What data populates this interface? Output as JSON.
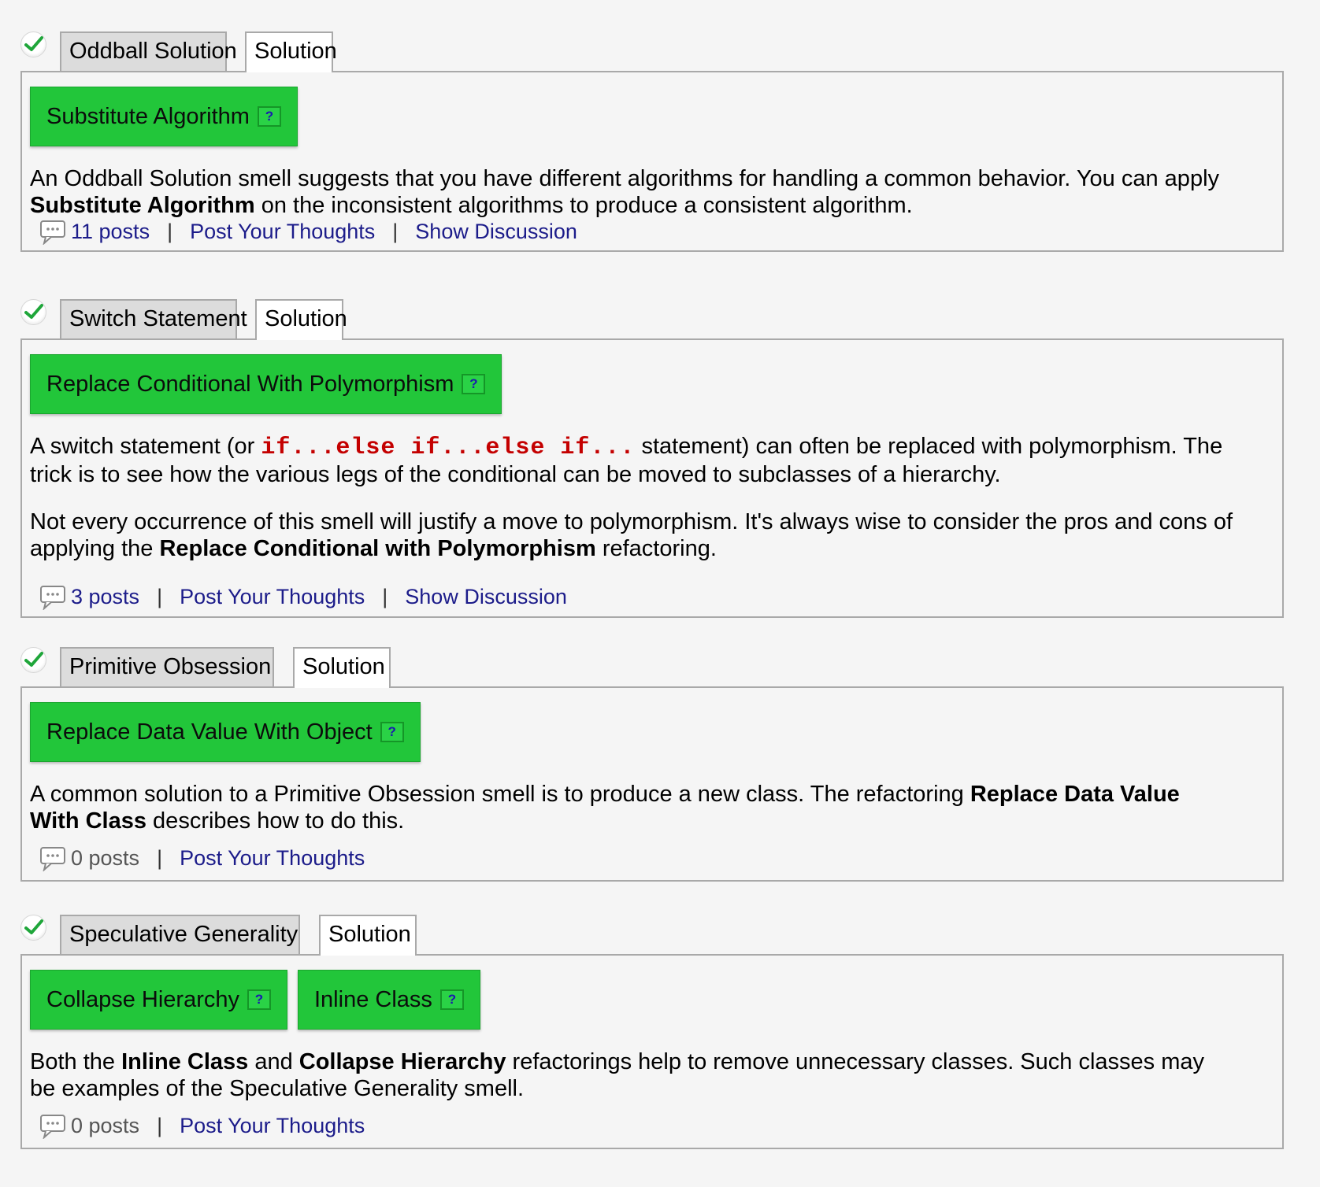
{
  "entries": [
    {
      "smell_tab": "Oddball Solution",
      "solution_tab": "Solution",
      "refactorings": [
        {
          "label": "Substitute Algorithm",
          "help": "?"
        }
      ],
      "desc_1": "An Oddball Solution smell suggests that you have different algorithms for handling a common behavior. You can apply ",
      "desc_bold": "Substitute Algorithm",
      "desc_2": " on the inconsistent algorithms to produce a consistent algorithm.",
      "posts": "11 posts",
      "post_thoughts": "Post Your Thoughts",
      "show_discussion": "Show Discussion",
      "separator": "|"
    },
    {
      "smell_tab": "Switch Statement",
      "solution_tab": "Solution",
      "refactorings": [
        {
          "label": "Replace Conditional With Polymorphism",
          "help": "?"
        }
      ],
      "desc_1": "A switch statement (or ",
      "desc_code": "if...else if...else if...",
      "desc_2": " statement) can often be replaced with polymorphism. The trick is to see how the various legs of the conditional can be moved to subclasses of a hierarchy.",
      "desc_3": "Not every occurrence of this smell will justify a move to polymorphism. It's always wise to consider the pros and cons of applying the ",
      "desc_bold": "Replace Conditional with Polymorphism",
      "desc_4": " refactoring.",
      "posts": "3 posts",
      "post_thoughts": "Post Your Thoughts",
      "show_discussion": "Show Discussion",
      "separator": "|"
    },
    {
      "smell_tab": "Primitive Obsession",
      "solution_tab": "Solution",
      "refactorings": [
        {
          "label": "Replace Data Value With Object",
          "help": "?"
        }
      ],
      "desc_1": "A common solution to a Primitive Obsession smell is to produce a new class. The refactoring ",
      "desc_bold": "Replace Data Value With Class",
      "desc_2": " describes how to do this.",
      "posts": "0 posts",
      "post_thoughts": "Post Your Thoughts",
      "separator": "|"
    },
    {
      "smell_tab": "Speculative Generality",
      "solution_tab": "Solution",
      "refactorings": [
        {
          "label": "Collapse Hierarchy",
          "help": "?"
        },
        {
          "label": "Inline Class",
          "help": "?"
        }
      ],
      "desc_1": "Both the ",
      "desc_bold_1": "Inline Class",
      "desc_2": " and ",
      "desc_bold_2": "Collapse Hierarchy",
      "desc_3": " refactorings help to remove unnecessary classes. Such classes may be examples of the Speculative Generality smell.",
      "posts": "0 posts",
      "post_thoughts": "Post Your Thoughts",
      "separator": "|"
    }
  ],
  "colors": {
    "refactoring_button": "#22c63a",
    "link": "#1c1c8a",
    "code": "#c40000",
    "check": "#1fa63a"
  },
  "icons": {
    "status": "checkmark-icon",
    "posts": "speech-bubble-icon",
    "help": "question-mark-icon"
  }
}
